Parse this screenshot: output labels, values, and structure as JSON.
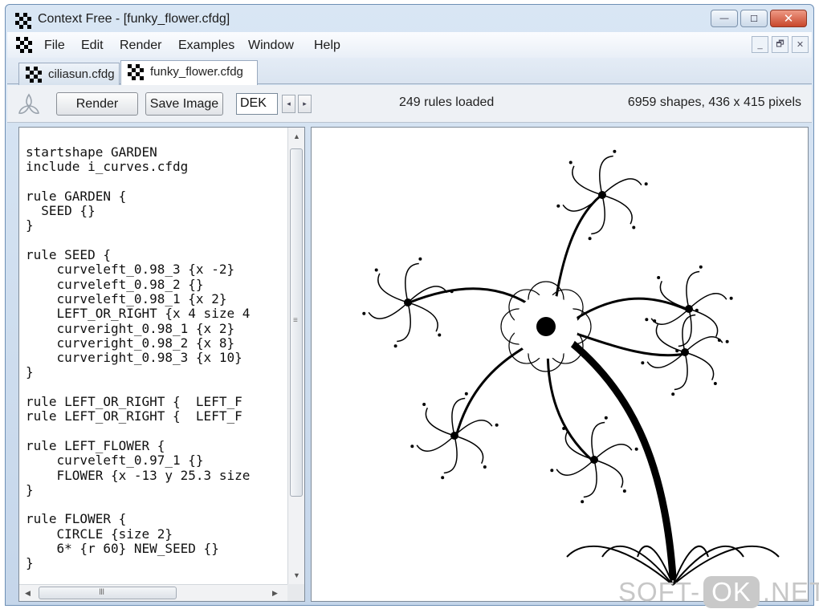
{
  "window": {
    "title": "Context Free - [funky_flower.cfdg]",
    "caption_minimize": "—",
    "caption_maximize": "☐",
    "caption_close": "✕"
  },
  "menu": {
    "items": [
      "File",
      "Edit",
      "Render",
      "Examples",
      "Window",
      "Help"
    ],
    "mdi_minimize": "_",
    "mdi_restore": "🗗",
    "mdi_close": "✕"
  },
  "tabs": [
    {
      "label": "ciliasun.cfdg",
      "active": false
    },
    {
      "label": "funky_flower.cfdg",
      "active": true
    }
  ],
  "toolbar": {
    "render_label": "Render",
    "save_label": "Save Image",
    "variation": "DEK",
    "spin_prev": "◂",
    "spin_next": "▸",
    "rules_status": "249 rules loaded",
    "shapes_status": "6959 shapes, 436 x 415 pixels"
  },
  "editor": {
    "lines": [
      "startshape GARDEN",
      "include i_curves.cfdg",
      "",
      "rule GARDEN {",
      "  SEED {}",
      "}",
      "",
      "rule SEED {",
      "    curveleft_0.98_3 {x -2}",
      "    curveleft_0.98_2 {}",
      "    curveleft_0.98_1 {x 2}",
      "    LEFT_OR_RIGHT {x 4 size 4",
      "    curveright_0.98_1 {x 2}",
      "    curveright_0.98_2 {x 8}",
      "    curveright_0.98_3 {x 10}",
      "}",
      "",
      "rule LEFT_OR_RIGHT {  LEFT_F",
      "rule LEFT_OR_RIGHT {  LEFT_F",
      "",
      "rule LEFT_FLOWER {",
      "    curveleft_0.97_1 {}",
      "    FLOWER {x -13 y 25.3 size",
      "}",
      "",
      "rule FLOWER {",
      "    CIRCLE {size 2}",
      "    6* {r 60} NEW_SEED {}",
      "}"
    ],
    "scroll_up": "▲",
    "scroll_down": "▼",
    "scroll_left": "◀",
    "scroll_right": "▶",
    "vgrip": "≡",
    "hgrip": "III"
  },
  "watermark": {
    "prefix": "SOFT-",
    "highlight": "OK",
    "suffix": ".NET"
  },
  "icons": {
    "app": "context-free-checker-icon",
    "logo": "tri-curve-logo-icon"
  },
  "colors": {
    "title_gradient_top": "#d9e6f4",
    "close_red": "#c8472c",
    "artwork_ink": "#000000"
  }
}
